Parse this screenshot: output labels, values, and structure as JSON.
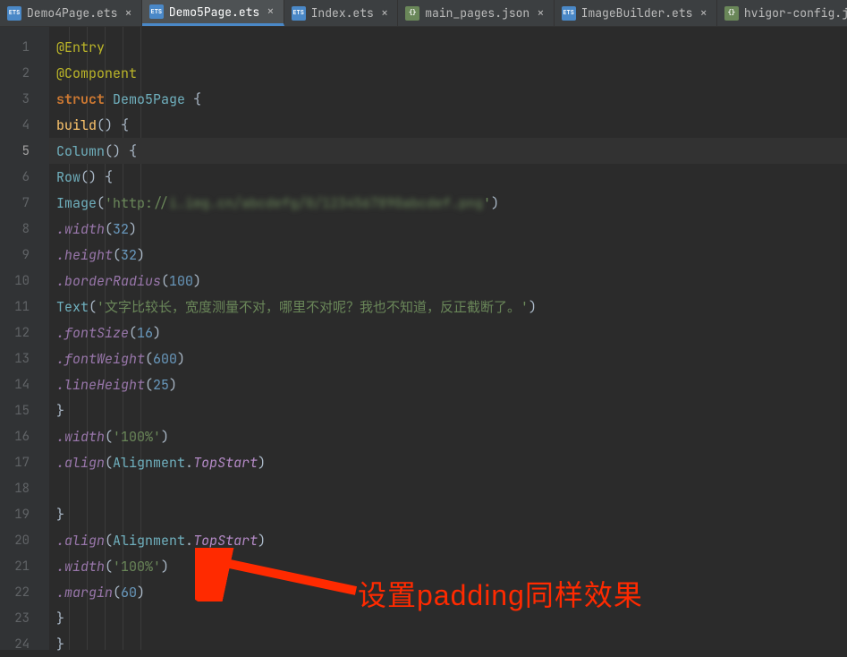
{
  "tabs": [
    {
      "label": "Demo4Page.ets",
      "type": "ets",
      "active": false
    },
    {
      "label": "Demo5Page.ets",
      "type": "ets",
      "active": true
    },
    {
      "label": "Index.ets",
      "type": "ets",
      "active": false
    },
    {
      "label": "main_pages.json",
      "type": "json",
      "active": false
    },
    {
      "label": "ImageBuilder.ets",
      "type": "ets",
      "active": false
    },
    {
      "label": "hvigor-config.js",
      "type": "json",
      "active": false
    }
  ],
  "gutter": {
    "start": 1,
    "end": 24,
    "current": 5
  },
  "code": {
    "structKeyword": "struct",
    "l1": "@Entry",
    "l2": "@Component",
    "l3_struct": "struct ",
    "l3_name": "Demo5Page",
    "l3_brace": " {",
    "l4_build": "build",
    "l4_rest": "() {",
    "l5_col": "Column",
    "l5_rest": "() {",
    "l6_row": "Row",
    "l6_rest": "() {",
    "l7_img": "Image",
    "l7_open": "(",
    "l7_str_a": "'http://",
    "l7_str_blur": "i.img.cn/abcdefg/0/1234567890abcdef.png",
    "l7_str_b": "'",
    "l7_close": ")",
    "l8_m": ".width",
    "l8_a": "(",
    "l8_n": "32",
    "l8_b": ")",
    "l9_m": ".height",
    "l9_a": "(",
    "l9_n": "32",
    "l9_b": ")",
    "l10_m": ".borderRadius",
    "l10_a": "(",
    "l10_n": "100",
    "l10_b": ")",
    "l11_txt": "Text",
    "l11_a": "(",
    "l11_s": "'文字比较长，宽度测量不对，哪里不对呢？我也不知道，反正截断了。'",
    "l11_b": ")",
    "l12_m": ".fontSize",
    "l12_a": "(",
    "l12_n": "16",
    "l12_b": ")",
    "l13_m": ".fontWeight",
    "l13_a": "(",
    "l13_n": "600",
    "l13_b": ")",
    "l14_m": ".lineHeight",
    "l14_a": "(",
    "l14_n": "25",
    "l14_b": ")",
    "l15": "}",
    "l16_m": ".width",
    "l16_a": "(",
    "l16_s": "'100%'",
    "l16_b": ")",
    "l17_m": ".align",
    "l17_a": "(",
    "l17_e1": "Alignment",
    "l17_dot": ".",
    "l17_e2": "TopStart",
    "l17_b": ")",
    "l18": "",
    "l19": "}",
    "l20_m": ".align",
    "l20_a": "(",
    "l20_e1": "Alignment",
    "l20_dot": ".",
    "l20_e2": "TopStart",
    "l20_b": ")",
    "l21_m": ".width",
    "l21_a": "(",
    "l21_s": "'100%'",
    "l21_b": ")",
    "l22_m": ".margin",
    "l22_a": "(",
    "l22_n": "60",
    "l22_b": ")",
    "l23": "}",
    "l24": "}"
  },
  "annotation": "设置padding同样效果",
  "colors": {
    "arrow": "#ff2a00"
  }
}
